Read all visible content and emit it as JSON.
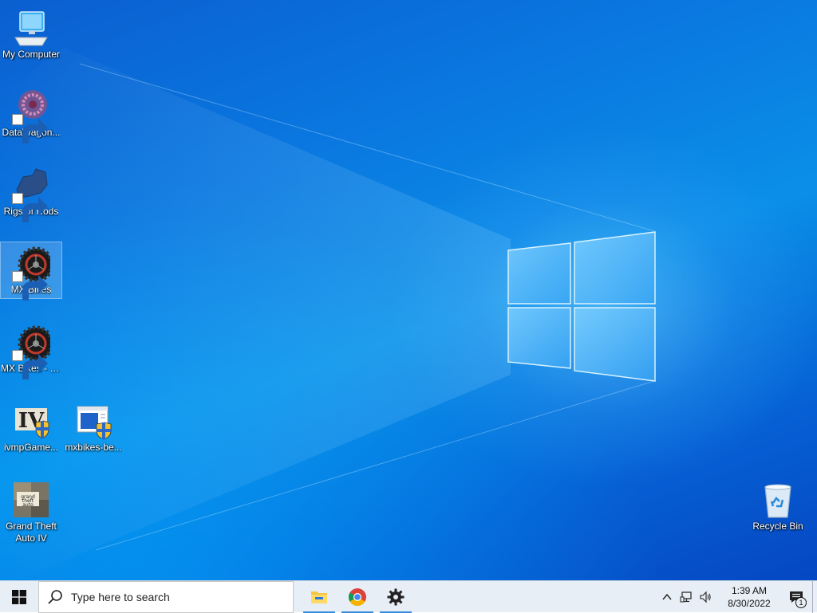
{
  "desktop": {
    "icons": [
      {
        "label": "My Computer"
      },
      {
        "label": "DataWagon..."
      },
      {
        "label": "Rigs of Rods"
      },
      {
        "label": "MX Bikes"
      },
      {
        "label": "MX Bikes - VR"
      },
      {
        "label": "ivmpGame..."
      },
      {
        "label": "mxbikes-be..."
      },
      {
        "label": "Grand Theft Auto IV"
      },
      {
        "label": "Recycle Bin"
      }
    ],
    "selected_icon": "MX Bikes",
    "wallpaper": "windows-10-light-beam"
  },
  "taskbar": {
    "start_icon": "windows-logo-icon",
    "search_placeholder": "Type here to search",
    "pinned_apps": [
      {
        "name": "File Explorer",
        "icon": "folder-icon",
        "running": true
      },
      {
        "name": "Google Chrome",
        "icon": "chrome-icon",
        "running": true
      },
      {
        "name": "Settings",
        "icon": "gear-icon",
        "running": true
      }
    ],
    "tray": {
      "time": "1:39 AM",
      "date": "8/30/2022",
      "notification_count": "1"
    }
  },
  "colors": {
    "wallpaper_blue": "#0a78e0",
    "taskbar_bg": "#e8eef5",
    "running_indicator": "#3b8ede"
  }
}
